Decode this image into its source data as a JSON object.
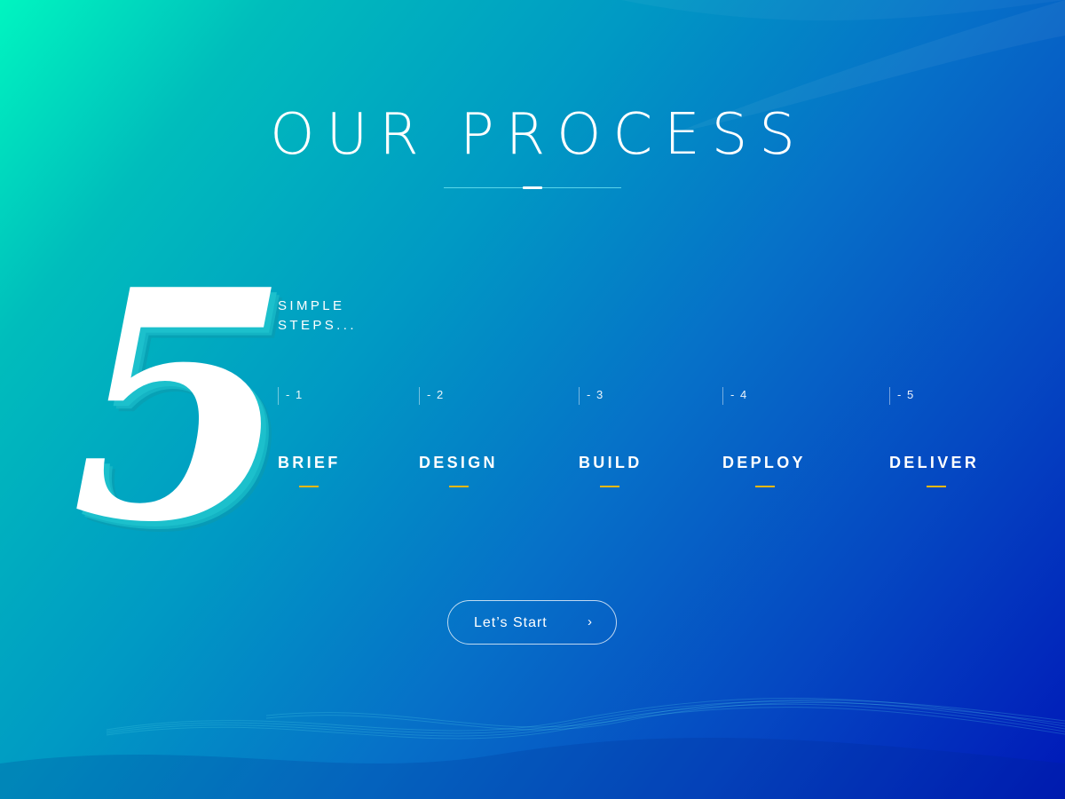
{
  "page": {
    "title": "OUR PROCESS",
    "big_number": "5",
    "subtitle_lines": [
      "SIMPLE",
      "STEPS..."
    ]
  },
  "steps": [
    {
      "number": "- 1",
      "label": "BRIEF"
    },
    {
      "number": "- 2",
      "label": "DESIGN"
    },
    {
      "number": "- 3",
      "label": "BUILD"
    },
    {
      "number": "- 4",
      "label": "DEPLOY"
    },
    {
      "number": "- 5",
      "label": "DELIVER"
    }
  ],
  "cta": {
    "label": "Let’s Start",
    "icon": "chevron-right-icon"
  },
  "colors": {
    "gradient_start": "#00f5c0",
    "gradient_end": "#0018b8",
    "accent_underline": "#f5b800",
    "number_face": "#ffffff",
    "number_depth": "#14b4c4",
    "text": "#ffffff"
  }
}
